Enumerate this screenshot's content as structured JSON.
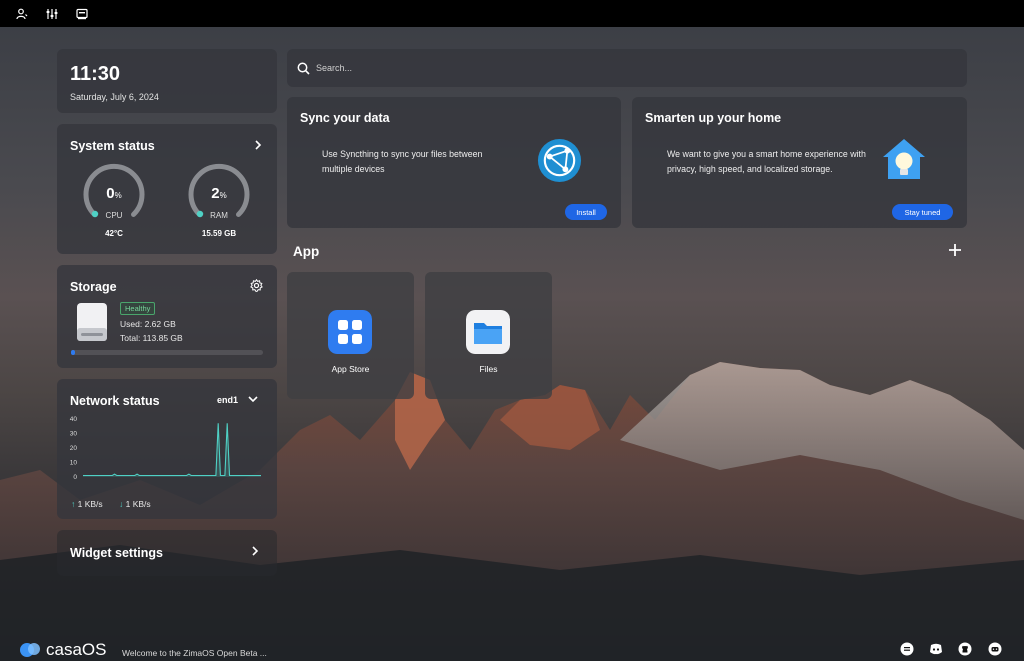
{
  "clock": {
    "time": "11:30",
    "date": "Saturday, July 6, 2024"
  },
  "system_status": {
    "title": "System status",
    "cpu": {
      "value": "0",
      "unit": "%",
      "label": "CPU",
      "sub": "42°C",
      "percent": 0
    },
    "ram": {
      "value": "2",
      "unit": "%",
      "label": "RAM",
      "sub": "15.59 GB",
      "percent": 2
    }
  },
  "storage": {
    "title": "Storage",
    "badge": "Healthy",
    "used": "Used: 2.62 GB",
    "total": "Total: 113.85 GB",
    "usage_fraction": 0.023
  },
  "network": {
    "title": "Network status",
    "interface": "end1",
    "y_ticks": [
      "40",
      "30",
      "20",
      "10",
      "0"
    ],
    "upload": "1 KB/s",
    "download": "1 KB/s"
  },
  "chart_data": {
    "type": "line",
    "title": "",
    "xlabel": "",
    "ylabel": "",
    "ylim": [
      0,
      40
    ],
    "y_ticks": [
      0,
      10,
      20,
      30,
      40
    ],
    "series": [
      {
        "color": "#4fd1c5",
        "values": [
          1,
          1,
          1,
          1,
          1,
          1,
          1,
          1,
          1,
          1,
          1,
          1,
          1,
          1,
          2,
          1,
          1,
          1,
          1,
          1,
          1,
          1,
          1,
          1,
          2,
          1,
          1,
          1,
          1,
          1,
          1,
          1,
          1,
          1,
          1,
          1,
          1,
          1,
          1,
          1,
          1,
          1,
          1,
          1,
          1,
          1,
          1,
          2,
          1,
          1,
          1,
          1,
          1,
          1,
          1,
          1,
          1,
          1,
          1,
          1,
          37,
          1,
          1,
          1,
          37,
          1,
          1,
          1,
          1,
          1,
          1,
          1,
          1,
          1,
          1,
          1,
          1,
          1,
          1,
          1
        ]
      }
    ]
  },
  "widget_settings": {
    "title": "Widget settings"
  },
  "search": {
    "placeholder": "Search..."
  },
  "promo_sync": {
    "title": "Sync your data",
    "description": "Use Syncthing to sync your files between multiple devices",
    "button": "Install"
  },
  "promo_home": {
    "title": "Smarten up your home",
    "description": "We want to give you a smart home experience with privacy, high speed, and localized storage.",
    "button": "Stay tuned"
  },
  "apps_section": {
    "title": "App"
  },
  "apps": [
    {
      "name": "App Store",
      "icon": "app-store-icon"
    },
    {
      "name": "Files",
      "icon": "files-icon"
    }
  ],
  "footer": {
    "logo_text": "casaOS",
    "welcome": "Welcome to the ZimaOS Open Beta ..."
  },
  "colors": {
    "accent": "#1f66e5",
    "teal": "#4fd1c5",
    "healthy": "#76d49a"
  }
}
